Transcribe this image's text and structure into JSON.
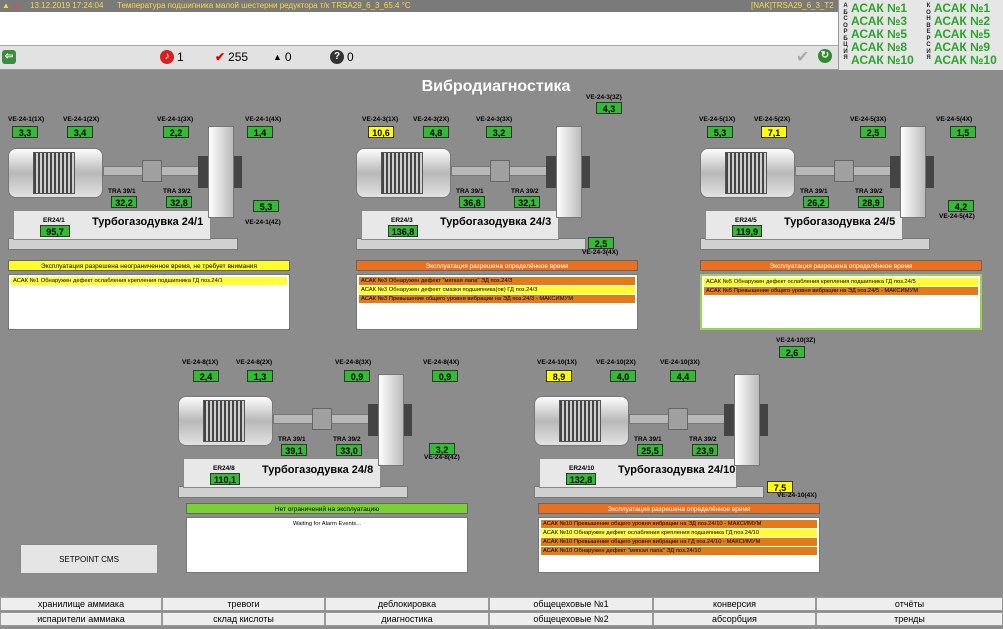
{
  "topbar": {
    "datetime": "13.12.2019 17:24:04",
    "message": "Температура подшипника малой шестерни редуктора т/к TRSA29_6_3_65.4 °C",
    "tag": "[NAK]TRSA29_6_3_T2"
  },
  "counters": {
    "alarms": "1",
    "acks": "255",
    "users": "0",
    "unknown": "0"
  },
  "right_panel": {
    "label_left": [
      "А",
      "Б",
      "С",
      "О",
      "Р",
      "Б",
      "Ц",
      "И",
      "Я"
    ],
    "label_right": [
      "К",
      "О",
      "Н",
      "В",
      "Е",
      "Р",
      "С",
      "И",
      "Я"
    ],
    "absorption": [
      "АСАК №1",
      "АСАК №3",
      "АСАК №5",
      "АСАК №8",
      "АСАК №10"
    ],
    "conversion": [
      "АСАК №1",
      "АСАК №2",
      "АСАК №5",
      "АСАК №9",
      "АСАК №10"
    ]
  },
  "title": "Вибродиагностика",
  "units": [
    {
      "name": "Турбогазодувка 24/1",
      "vib": [
        {
          "label": "VE-24-1(1X)",
          "value": "3,3",
          "color": "green"
        },
        {
          "label": "VE-24-1(2X)",
          "value": "3,4",
          "color": "green"
        },
        {
          "label": "VE-24-1(3X)",
          "value": "2,2",
          "color": "green"
        },
        {
          "label": "VE-24-1(4X)",
          "value": "1,4",
          "color": "green"
        },
        {
          "label": "VE-24-1(4Z)",
          "value": "5,3",
          "color": "green"
        }
      ],
      "tra1_label": "TRA 39/1",
      "tra1": "32,2",
      "tra2_label": "TRA 39/2",
      "tra2": "32,8",
      "er_label": "ER24/1",
      "er": "95,7",
      "status": "Эксплуатация разрешена неограниченное время, не требует внимания",
      "status_color": "yellow",
      "messages": [
        {
          "text": "АСАК №1 Обнаружен дефект ослабления крепления подшипника ГД поз.24/1",
          "color": "yellow"
        }
      ]
    },
    {
      "name": "Турбогазодувка 24/3",
      "vib": [
        {
          "label": "VE-24-3(1X)",
          "value": "10,6",
          "color": "yellow"
        },
        {
          "label": "VE-24-3(2X)",
          "value": "4,8",
          "color": "green"
        },
        {
          "label": "VE-24-3(3X)",
          "value": "3,2",
          "color": "green"
        },
        {
          "label": "VE-24-3(3Z)",
          "value": "4,3",
          "color": "green"
        },
        {
          "label": "VE-24-3(4X)",
          "value": "2,5",
          "color": "green"
        }
      ],
      "tra1_label": "TRA 39/1",
      "tra1": "36,8",
      "tra2_label": "TRA 39/2",
      "tra2": "32,1",
      "er_label": "ER24/3",
      "er": "136,8",
      "status": "Эксплуатация разрешена определённое время",
      "status_color": "orange",
      "messages": [
        {
          "text": "АСАК №3 Обнаружен дефект \"мягкая лапа\" ЭД поз.24/3",
          "color": "orange"
        },
        {
          "text": "АСАК №3 Обнаружен дефект смазки подшипника(ов) ГД поз.24/3",
          "color": "yellow"
        },
        {
          "text": "АСАК №3 Превышение общего уровня вибрации на ЭД поз.24/3 - МАКСИМУМ",
          "color": "orange"
        }
      ]
    },
    {
      "name": "Турбогазодувка 24/5",
      "vib": [
        {
          "label": "VE-24-5(1X)",
          "value": "5,3",
          "color": "green"
        },
        {
          "label": "VE-24-5(2X)",
          "value": "7,1",
          "color": "yellow"
        },
        {
          "label": "VE-24-5(3X)",
          "value": "2,5",
          "color": "green"
        },
        {
          "label": "VE-24-5(4X)",
          "value": "1,5",
          "color": "green"
        },
        {
          "label": "VE-24-5(4Z)",
          "value": "4,2",
          "color": "green"
        }
      ],
      "tra1_label": "TRA 39/1",
      "tra1": "26,2",
      "tra2_label": "TRA 39/2",
      "tra2": "28,9",
      "er_label": "ER24/5",
      "er": "119,9",
      "status": "Эксплуатация разрешена определённое время",
      "status_color": "orange",
      "messages": [
        {
          "text": "АСАК №5 Обнаружен дефект ослабления крепления подшипника ГД поз.24/5",
          "color": "yellow"
        },
        {
          "text": "АСАК №5 Превышение общего уровня вибрации на ЭД поз.24/5 - МАКСИМУМ",
          "color": "orange"
        }
      ]
    },
    {
      "name": "Турбогазодувка 24/8",
      "vib": [
        {
          "label": "VE-24-8(1X)",
          "value": "2,4",
          "color": "green"
        },
        {
          "label": "VE-24-8(2X)",
          "value": "1,3",
          "color": "green"
        },
        {
          "label": "VE-24-8(3X)",
          "value": "0,9",
          "color": "green"
        },
        {
          "label": "VE-24-8(4X)",
          "value": "0,9",
          "color": "green"
        },
        {
          "label": "VE-24-8(4Z)",
          "value": "3,2",
          "color": "green"
        }
      ],
      "tra1_label": "TRA 39/1",
      "tra1": "39,1",
      "tra2_label": "TRA 39/2",
      "tra2": "33,0",
      "er_label": "ER24/8",
      "er": "110,1",
      "status": "Нет ограничений на эксплуатацию",
      "status_color": "green",
      "messages": [
        {
          "text": "Waiting for Alarm Events...",
          "color": "white"
        }
      ]
    },
    {
      "name": "Турбогазодувка 24/10",
      "vib": [
        {
          "label": "VE-24-10(1X)",
          "value": "8,9",
          "color": "yellow"
        },
        {
          "label": "VE-24-10(2X)",
          "value": "4,0",
          "color": "green"
        },
        {
          "label": "VE-24-10(3X)",
          "value": "4,4",
          "color": "green"
        },
        {
          "label": "VE-24-10(3Z)",
          "value": "2,6",
          "color": "green"
        },
        {
          "label": "VE-24-10(4X)",
          "value": "7,5",
          "color": "yellow"
        }
      ],
      "tra1_label": "TRA 39/1",
      "tra1": "25,5",
      "tra2_label": "TRA 39/2",
      "tra2": "23,9",
      "er_label": "ER24/10",
      "er": "132,8",
      "status": "Эксплуатация разрешена определённое время",
      "status_color": "orange",
      "messages": [
        {
          "text": "АСАК №10 Превышение общего уровня вибрации на ЭД поз.24/10 - МАКСИМУМ",
          "color": "orange"
        },
        {
          "text": "АСАК №10 Обнаружен дефект ослабления крепления подшипника ГД поз.24/10",
          "color": "yellow"
        },
        {
          "text": "АСАК №10 Превышение общего уровня вибрации на ГД поз.24/10 - МАКСИМУМ",
          "color": "orange"
        },
        {
          "text": "АСАК №10 Обнаружен дефект \"мягкая лапа\" ЭД поз.24/10",
          "color": "orange"
        }
      ]
    }
  ],
  "setpoint_button": "SETPOINT CMS",
  "nav_top": [
    "хранилище аммиака",
    "тревоги",
    "деблокировка",
    "общецеховые №1",
    "конверсия",
    "отчёты"
  ],
  "nav_bottom": [
    "испарители аммиака",
    "склад кислоты",
    "диагностика",
    "общецеховые №2",
    "абсорбция",
    "тренды"
  ]
}
